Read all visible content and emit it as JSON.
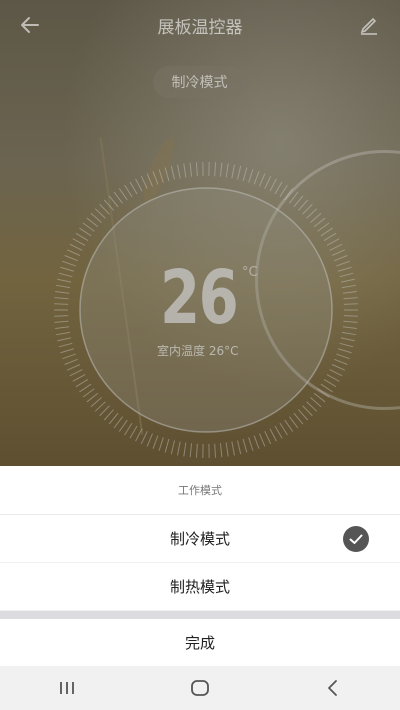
{
  "header": {
    "title": "展板温控器"
  },
  "mode_pill": "制冷模式",
  "dial": {
    "temperature": "26",
    "unit": "°C",
    "indoor_label": "室内温度 26°C"
  },
  "sheet": {
    "title": "工作模式",
    "options": [
      {
        "label": "制冷模式",
        "selected": true
      },
      {
        "label": "制热模式",
        "selected": false
      }
    ],
    "done_label": "完成"
  },
  "colors": {
    "check_bg": "#555555",
    "text": "#222222"
  },
  "nav_icons": [
    "recent-apps-icon",
    "home-icon",
    "back-nav-icon"
  ]
}
